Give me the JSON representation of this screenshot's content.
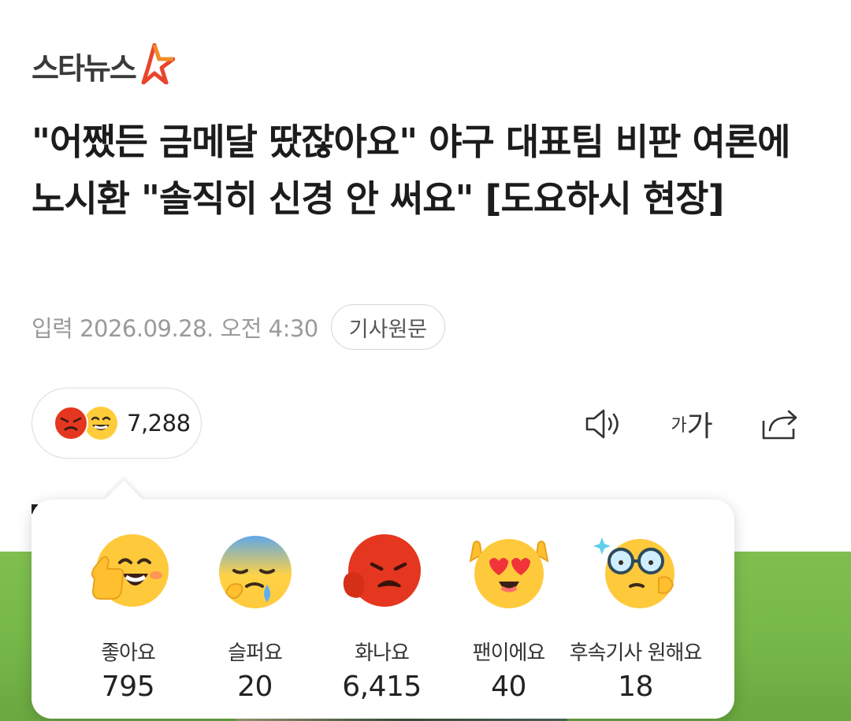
{
  "brand": {
    "logo_text": "스타뉴스"
  },
  "article": {
    "headline": "\"어쨌든 금메달 땄잖아요\" 야구 대표팀 비판 여론에 노시환 \"솔직히 신경 안 써요\" [도요하시 현장]",
    "date": "입력 2026.09.28. 오전 4:30",
    "origin_button": "기사원문"
  },
  "reaction_summary": {
    "count": "7,288",
    "icons": [
      "angry-face-icon",
      "happy-face-icon"
    ]
  },
  "toolbar": {
    "tts_icon": "speaker-icon",
    "font_small": "가",
    "font_big": "가",
    "share_icon": "share-icon"
  },
  "reactions": [
    {
      "label": "좋아요",
      "count": "795",
      "icon": "thumbs-up-face-icon"
    },
    {
      "label": "슬퍼요",
      "count": "20",
      "icon": "sad-face-icon"
    },
    {
      "label": "화나요",
      "count": "6,415",
      "icon": "angry-face-icon"
    },
    {
      "label": "팬이에요",
      "count": "40",
      "icon": "heart-eyes-face-icon"
    },
    {
      "label": "후속기사 원해요",
      "count": "18",
      "icon": "glasses-face-icon"
    }
  ],
  "colors": {
    "brand_red": "#e8452c",
    "brand_orange": "#f28c28",
    "emoji_yellow": "#ffcc3a",
    "angry_red": "#e5361f"
  }
}
